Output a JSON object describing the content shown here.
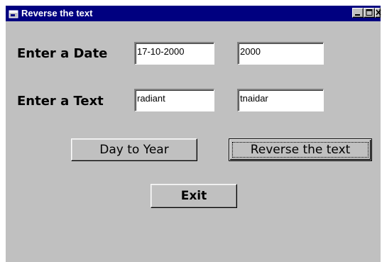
{
  "window": {
    "title": "Reverse the text"
  },
  "form": {
    "date_label": "Enter a Date",
    "date_input": "17-10-2000",
    "date_output": "2000",
    "text_label": "Enter a Text",
    "text_input": "radiant",
    "text_output": "tnaidar"
  },
  "buttons": {
    "day_to_year": "Day to Year",
    "reverse_text": "Reverse the text",
    "exit": "Exit"
  },
  "icons": {
    "app": "app-window-icon",
    "minimize": "minimize-icon",
    "maximize": "maximize-icon",
    "close": "close-icon"
  },
  "colors": {
    "titlebar": "#000080",
    "face": "#c0c0c0"
  }
}
